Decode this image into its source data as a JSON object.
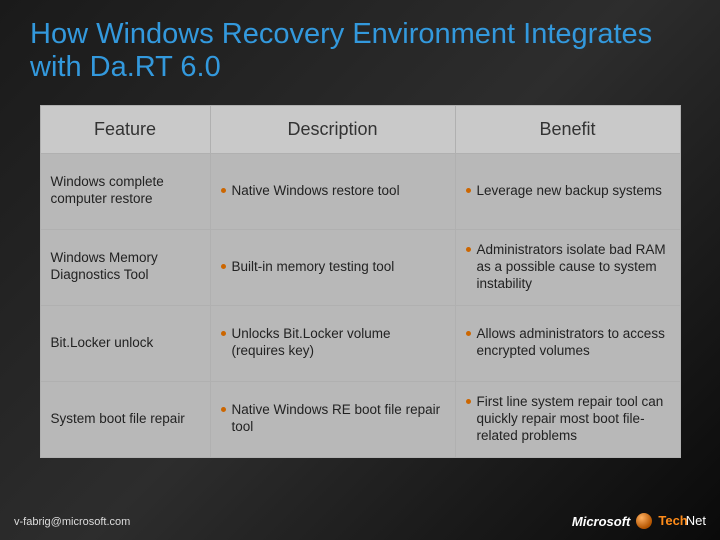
{
  "title": "How Windows Recovery Environment Integrates with Da.RT 6.0",
  "headers": {
    "feature": "Feature",
    "description": "Description",
    "benefit": "Benefit"
  },
  "rows": [
    {
      "feature": "Windows complete computer restore",
      "description": "Native Windows restore tool",
      "benefit": "Leverage new backup systems"
    },
    {
      "feature": "Windows Memory Diagnostics Tool",
      "description": "Built-in memory testing tool",
      "benefit": "Administrators isolate bad RAM as a possible cause to system instability"
    },
    {
      "feature": "Bit.Locker unlock",
      "description": "Unlocks Bit.Locker volume (requires key)",
      "benefit": "Allows administrators to access encrypted volumes"
    },
    {
      "feature": "System boot file repair",
      "description": "Native Windows RE  boot file repair tool",
      "benefit": "First line system repair tool can quickly repair most boot file-related problems"
    }
  ],
  "footer_email": "v-fabrig@microsoft.com",
  "brand": {
    "company": "Microsoft",
    "product_a": "Tech",
    "product_b": "Net"
  }
}
